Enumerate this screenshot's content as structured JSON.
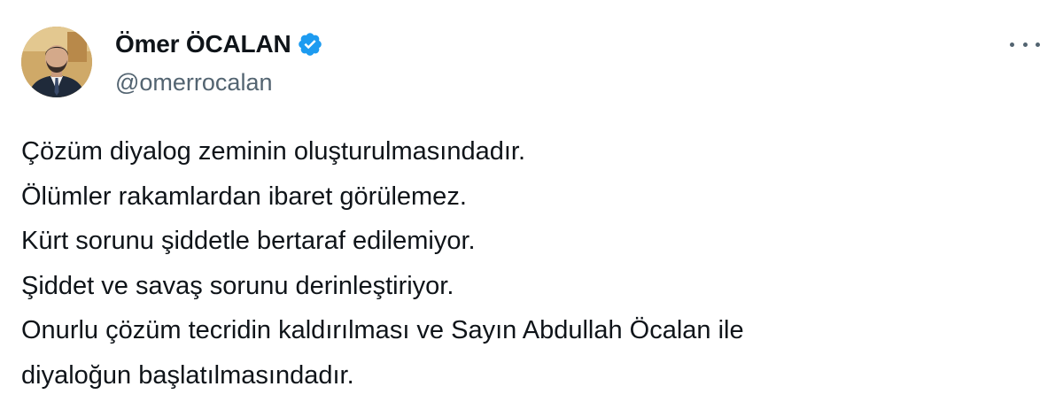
{
  "author": {
    "display_name": "Ömer ÖCALAN",
    "handle": "@omerrocalan",
    "verified": true,
    "verified_color": "#1d9bf0"
  },
  "menu": {
    "icon": "more-horizontal-icon"
  },
  "tweet": {
    "lines": [
      "Çözüm diyalog zeminin oluşturulmasındadır.",
      "Ölümler rakamlardan ibaret görülemez.",
      "Kürt sorunu şiddetle bertaraf edilemiyor.",
      "Şiddet ve savaş sorunu derinleştiriyor.",
      "Onurlu çözüm tecridin kaldırılması ve Sayın Abdullah Öcalan ile",
      "diyaloğun başlatılmasındadır."
    ]
  },
  "colors": {
    "text_primary": "#0f1419",
    "text_secondary": "#536471",
    "background": "#ffffff"
  }
}
